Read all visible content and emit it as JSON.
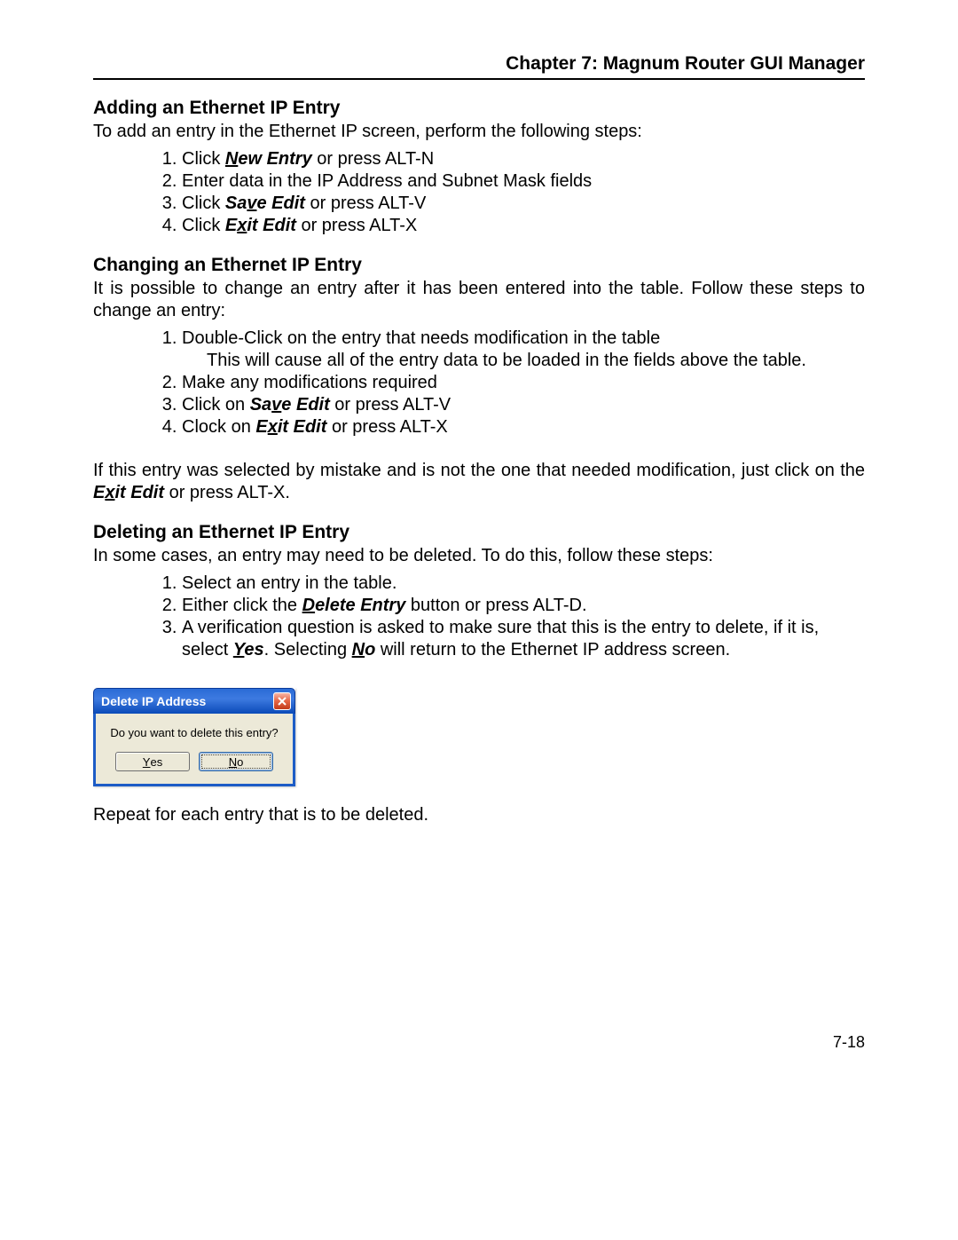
{
  "header": {
    "chapter": "Chapter 7: Magnum Router GUI Manager"
  },
  "sections": {
    "adding": {
      "heading": "Adding an Ethernet IP Entry",
      "intro": "To add an entry in the Ethernet IP screen, perform the following steps:",
      "steps": {
        "s1_a": "Click ",
        "s1_b_underline": "N",
        "s1_b_rest": "ew Entry",
        "s1_c": " or press ALT-N",
        "s2": "Enter data in the IP Address and Subnet Mask fields",
        "s3_a": "Click ",
        "s3_b_pre": "Sa",
        "s3_b_underline": "v",
        "s3_b_post": "e Edit",
        "s3_c": " or press ALT-V",
        "s4_a": "Click ",
        "s4_b_pre": "E",
        "s4_b_underline": "x",
        "s4_b_post": "it Edit",
        "s4_c": " or press ALT-X"
      }
    },
    "changing": {
      "heading": "Changing an Ethernet IP Entry",
      "intro": "It is possible to change an entry after it has been entered into the table.  Follow these steps to change an entry:",
      "steps": {
        "s1": "Double-Click on the entry that needs modification in the table",
        "s1_sub": "This will cause all of the entry data to be loaded in the fields above the table.",
        "s2": "Make any modifications required",
        "s3_a": "Click on ",
        "s3_b_pre": "Sa",
        "s3_b_underline": "v",
        "s3_b_post": "e Edit",
        "s3_c": " or press ALT-V",
        "s4_a": "Clock on ",
        "s4_b_pre": "E",
        "s4_b_underline": "x",
        "s4_b_post": "it Edit",
        "s4_c": " or press ALT-X"
      },
      "note_a": "If this entry was selected by mistake and is not the one that needed modification, just click on the ",
      "note_b_pre": "E",
      "note_b_underline": "x",
      "note_b_post": "it Edit",
      "note_c": " or press ALT-X."
    },
    "deleting": {
      "heading": "Deleting an Ethernet IP Entry",
      "intro": "In some cases, an entry may need to be deleted.  To do this, follow these steps:",
      "steps": {
        "s1": "Select an entry in the table.",
        "s2_a": "Either click the ",
        "s2_b_underline": "D",
        "s2_b_rest": "elete Entry",
        "s2_c": " button or press ALT-D.",
        "s3_a": "A verification question is asked to make sure that this is the entry to delete, if it is, select ",
        "s3_yes_underline": "Y",
        "s3_yes_rest": "es",
        "s3_b": ".  Selecting ",
        "s3_no_underline": "N",
        "s3_no_rest": "o",
        "s3_c": " will return to the Ethernet IP address screen."
      },
      "after": "Repeat for each entry that is to be deleted."
    }
  },
  "dialog": {
    "title": "Delete IP Address",
    "message": "Do you want to delete this entry?",
    "yes_underline": "Y",
    "yes_rest": "es",
    "no_underline": "N",
    "no_rest": "o"
  },
  "page_number": "7-18"
}
